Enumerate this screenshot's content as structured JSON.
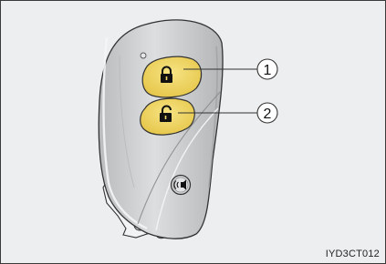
{
  "callouts": [
    {
      "number": "1",
      "target": "lock-button",
      "icon": "padlock-closed-icon"
    },
    {
      "number": "2",
      "target": "unlock-button",
      "icon": "padlock-open-icon"
    }
  ],
  "panic_button_icon": "panic-alarm-icon",
  "image_code": "IYD3CT012",
  "colors": {
    "background": "#eceeef",
    "fob_body": "#c9cbcd",
    "button_yellow": "#f1d96a",
    "outline": "#333333"
  }
}
